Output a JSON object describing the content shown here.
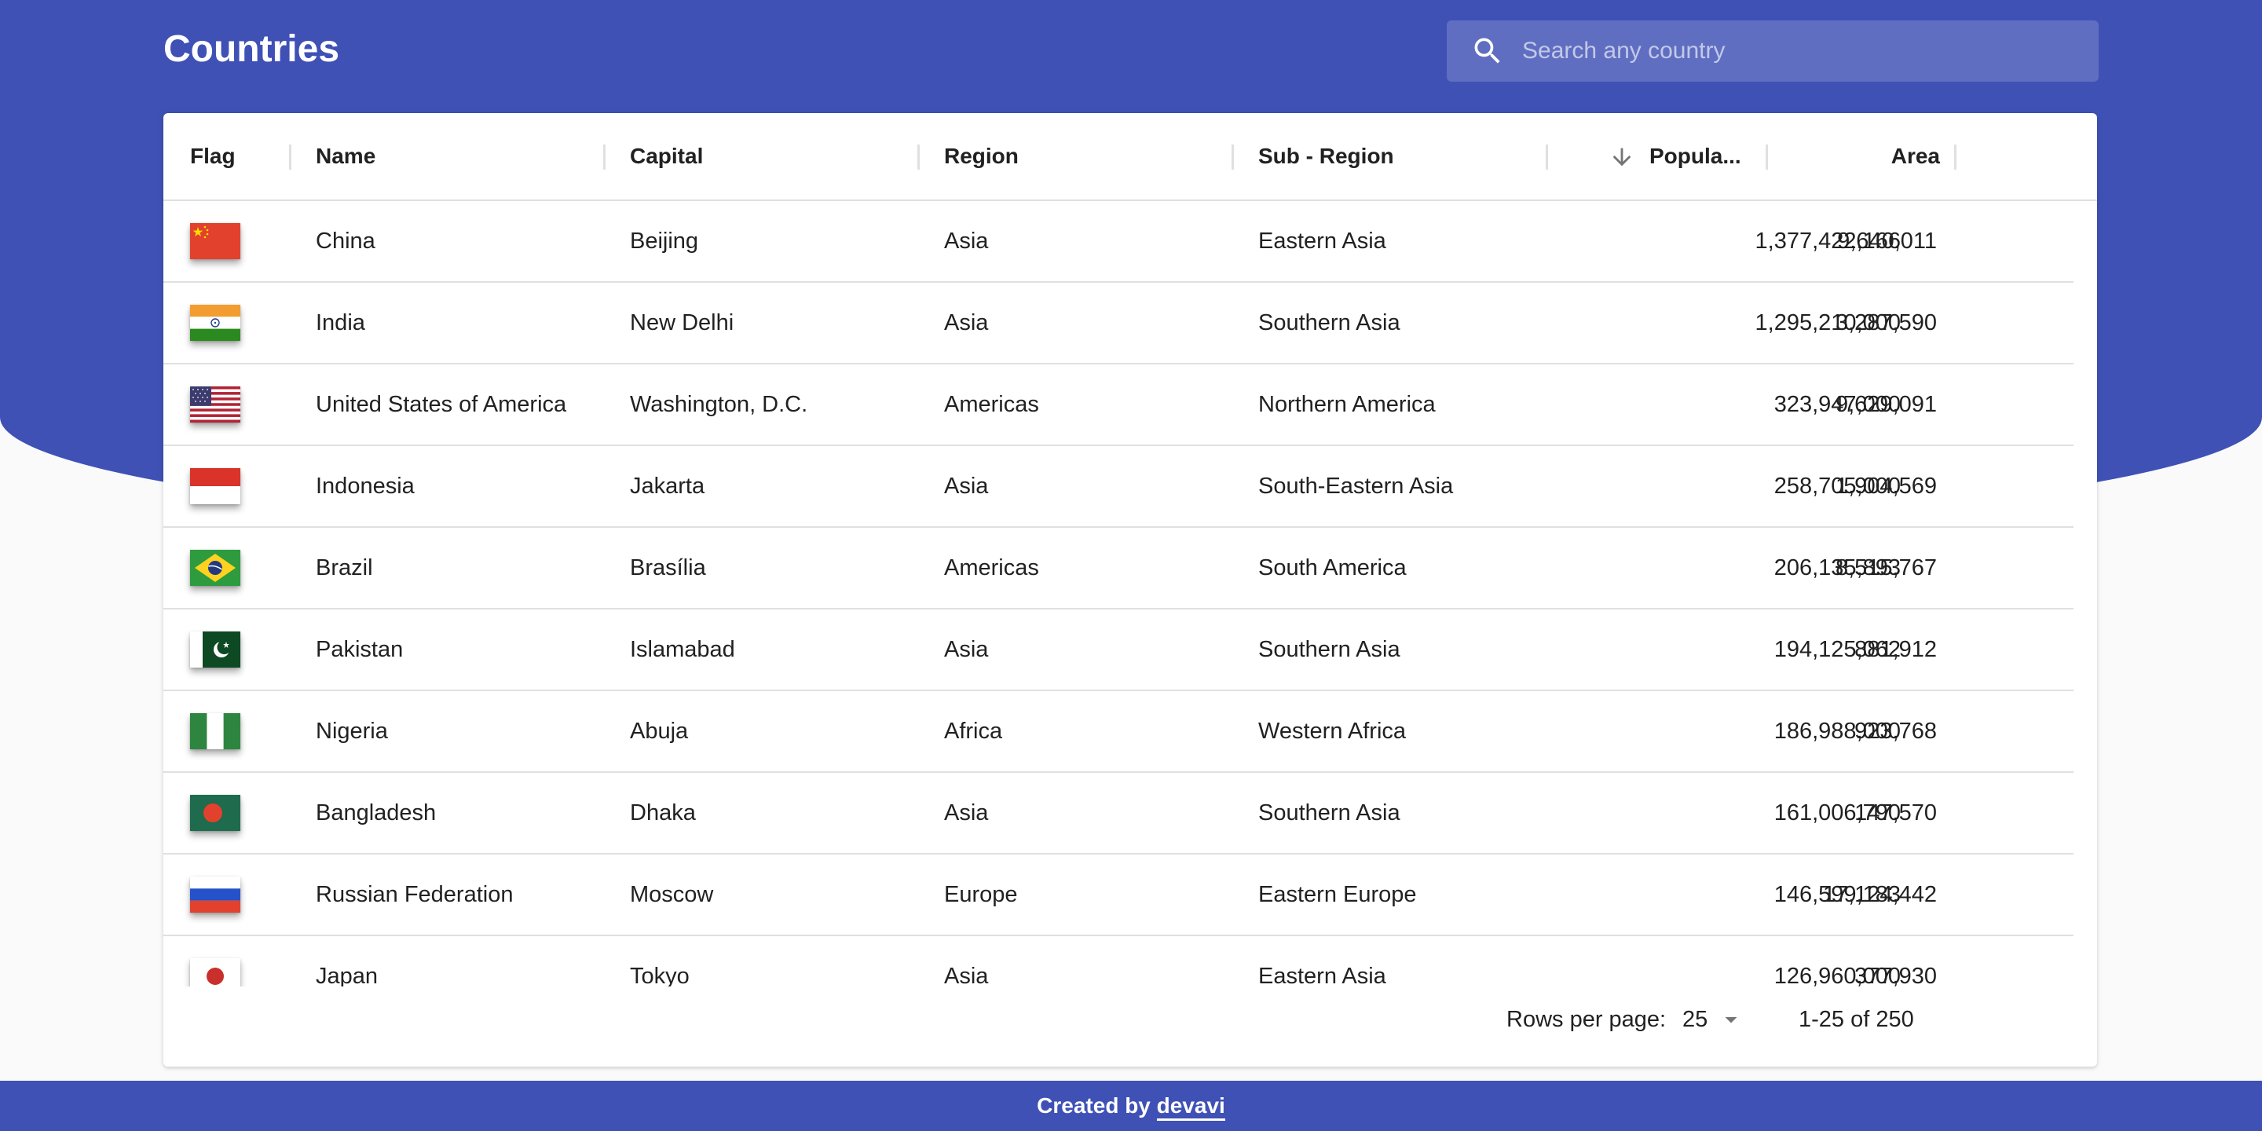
{
  "header": {
    "title": "Countries",
    "search_placeholder": "Search any country",
    "search_value": "",
    "accent_color": "#3f51b5"
  },
  "table": {
    "columns": {
      "flag": "Flag",
      "name": "Name",
      "capital": "Capital",
      "region": "Region",
      "subregion": "Sub - Region",
      "population": "Popula...",
      "area": "Area"
    },
    "sort": {
      "column": "population",
      "direction": "descending",
      "icon": "arrow-down-icon"
    },
    "rows": [
      {
        "flag": "china",
        "name": "China",
        "capital": "Beijing",
        "region": "Asia",
        "subregion": "Eastern Asia",
        "population": "1,377,422,166",
        "area": "9,640,011"
      },
      {
        "flag": "india",
        "name": "India",
        "capital": "New Delhi",
        "region": "Asia",
        "subregion": "Southern Asia",
        "population": "1,295,210,000",
        "area": "3,287,590"
      },
      {
        "flag": "usa",
        "name": "United States of America",
        "capital": "Washington, D.C.",
        "region": "Americas",
        "subregion": "Northern America",
        "population": "323,947,000",
        "area": "9,629,091"
      },
      {
        "flag": "indonesia",
        "name": "Indonesia",
        "capital": "Jakarta",
        "region": "Asia",
        "subregion": "South-Eastern Asia",
        "population": "258,705,000",
        "area": "1,904,569"
      },
      {
        "flag": "brazil",
        "name": "Brazil",
        "capital": "Brasília",
        "region": "Americas",
        "subregion": "South America",
        "population": "206,135,893",
        "area": "8,515,767"
      },
      {
        "flag": "pakistan",
        "name": "Pakistan",
        "capital": "Islamabad",
        "region": "Asia",
        "subregion": "Southern Asia",
        "population": "194,125,062",
        "area": "881,912"
      },
      {
        "flag": "nigeria",
        "name": "Nigeria",
        "capital": "Abuja",
        "region": "Africa",
        "subregion": "Western Africa",
        "population": "186,988,000",
        "area": "923,768"
      },
      {
        "flag": "bangladesh",
        "name": "Bangladesh",
        "capital": "Dhaka",
        "region": "Asia",
        "subregion": "Southern Asia",
        "population": "161,006,790",
        "area": "147,570"
      },
      {
        "flag": "russia",
        "name": "Russian Federation",
        "capital": "Moscow",
        "region": "Europe",
        "subregion": "Eastern Europe",
        "population": "146,599,183",
        "area": "17,124,442"
      },
      {
        "flag": "japan",
        "name": "Japan",
        "capital": "Tokyo",
        "region": "Asia",
        "subregion": "Eastern Asia",
        "population": "126,960,000",
        "area": "377,930"
      }
    ]
  },
  "pagination": {
    "rows_per_page_label": "Rows per page:",
    "rows_per_page_value": "25",
    "range_text": "1-25 of 250",
    "prev_icon": "chevron-left-icon",
    "next_icon": "chevron-right-icon"
  },
  "footer": {
    "prefix": "Created by",
    "link_text": "devavi"
  }
}
